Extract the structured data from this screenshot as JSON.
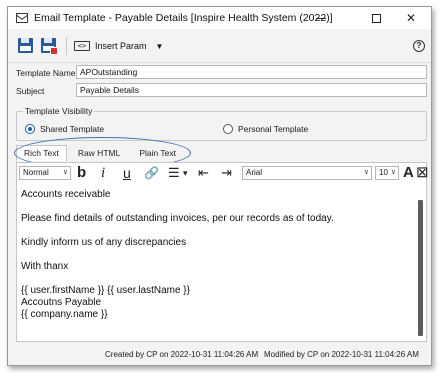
{
  "window": {
    "title": "Email Template - Payable Details [Inspire Health System (2022)]",
    "minimize_glyph": "",
    "maximize_glyph": "",
    "close_glyph": "✕"
  },
  "toolbar": {
    "insert_param_label": "Insert Param",
    "insert_param_icon_text": "<>",
    "help_glyph": "?"
  },
  "form": {
    "template_name_label": "Template Name",
    "template_name_value": "APOutstanding",
    "subject_label": "Subject",
    "subject_value": "Payable Details"
  },
  "visibility": {
    "legend": "Template Visibility",
    "shared_label": "Shared Template",
    "personal_label": "Personal Template",
    "selected": "shared"
  },
  "tabs": [
    {
      "label": "Rich Text",
      "active": true
    },
    {
      "label": "Raw HTML",
      "active": false
    },
    {
      "label": "Plain Text",
      "active": false
    }
  ],
  "format_bar": {
    "style_value": "Normal",
    "font_value": "Arial",
    "size_value": "10",
    "bold_glyph": "b",
    "italic_glyph": "i",
    "underline_glyph": "u",
    "link_glyph": "🔗",
    "list_glyph": "☰",
    "list_caret": "▾",
    "outdent_glyph": "⇤",
    "indent_glyph": "⇥",
    "font_color_glyph": "A",
    "clear_glyph": "⊠"
  },
  "editor": {
    "lines": [
      "Accounts receivable",
      "",
      "Please find details of outstanding invoices, per our records as of today.",
      "",
      "Kindly inform us of any discrepancies",
      "",
      "With thanx",
      "",
      "{{ user.firstName }} {{ user.lastName }}",
      "Accoutns Payable",
      "{{ company.name }}"
    ]
  },
  "footer": {
    "created": "Created by CP on 2022-10-31 11:04:26 AM",
    "modified": "Modified by CP on 2022-10-31 11:04:26 AM"
  },
  "colors": {
    "accent": "#1f5fb0",
    "annotation_ellipse": "#3a6fb5",
    "save_icon": "#2a5a9a",
    "save_close_badge": "#d0342c"
  }
}
